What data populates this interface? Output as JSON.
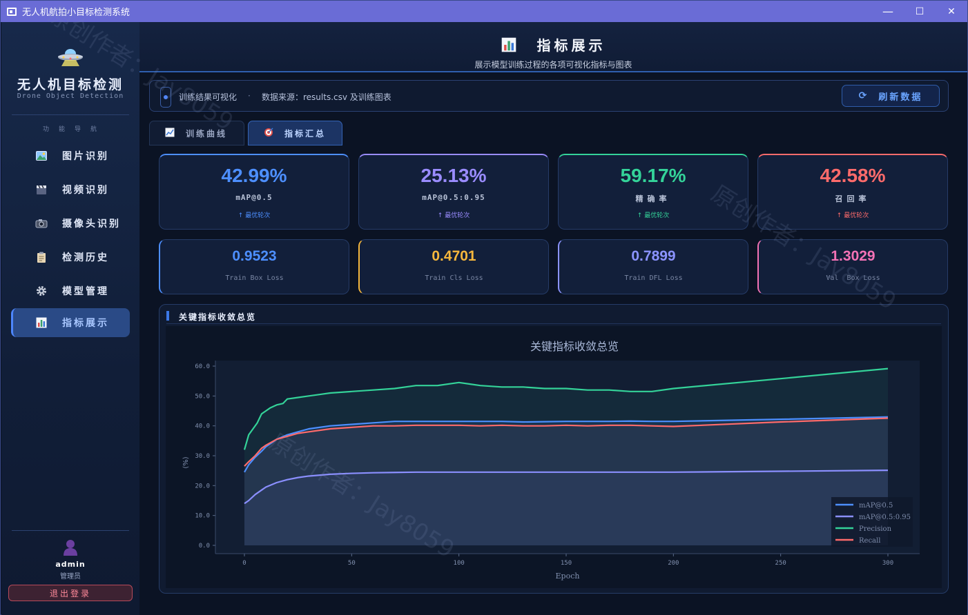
{
  "window": {
    "title": "无人机航拍小目标检测系统",
    "controls": [
      "—",
      "☐",
      "✕"
    ]
  },
  "sidebar": {
    "brand_title": "无人机目标检测",
    "brand_sub": "Drone Object Detection",
    "nav_caption": "功能导航",
    "items": [
      {
        "label": "图片识别",
        "icon": "image-icon"
      },
      {
        "label": "视频识别",
        "icon": "clapper-icon"
      },
      {
        "label": "摄像头识别",
        "icon": "camera-icon"
      },
      {
        "label": "检测历史",
        "icon": "clipboard-icon"
      },
      {
        "label": "模型管理",
        "icon": "gear-icon"
      },
      {
        "label": "指标展示",
        "icon": "bar-chart-icon",
        "active": true
      }
    ],
    "user": {
      "name": "admin",
      "role": "管理员"
    },
    "logout_label": "退出登录"
  },
  "header": {
    "title": "指标展示",
    "subtitle": "展示模型训练过程的各项可视化指标与图表"
  },
  "infobar": {
    "text": "训练结果可视化",
    "separator": "·",
    "source": "数据来源：results.csv 及训练图表",
    "refresh_label": "刷新数据"
  },
  "tabs": [
    {
      "label": "训练曲线",
      "active": false
    },
    {
      "label": "指标汇总",
      "active": true
    }
  ],
  "metric_cards": [
    {
      "value": "42.99%",
      "label": "mAP@0.5",
      "note": "↑ 最优轮次",
      "color": "#4d8fff"
    },
    {
      "value": "25.13%",
      "label": "mAP@0.5:0.95",
      "note": "↑ 最优轮次",
      "color": "#9a8cff"
    },
    {
      "value": "59.17%",
      "label": "精确率",
      "note": "↑ 最优轮次",
      "color": "#34d399"
    },
    {
      "value": "42.58%",
      "label": "召回率",
      "note": "↑ 最优轮次",
      "color": "#ff6b6b"
    }
  ],
  "loss_cards": [
    {
      "value": "0.9523",
      "label": "Train Box Loss",
      "color": "#4d8fff"
    },
    {
      "value": "0.4701",
      "label": "Train Cls Loss",
      "color": "#f6b73c"
    },
    {
      "value": "0.7899",
      "label": "Train DFL Loss",
      "color": "#8b93ff"
    },
    {
      "value": "1.3029",
      "label": "Val  Box Loss",
      "color": "#f472b6"
    }
  ],
  "chart_panel_title": "关键指标收敛总览",
  "chart_data": {
    "type": "line",
    "title": "关键指标收敛总览",
    "xlabel": "Epoch",
    "ylabel": "(%)",
    "xlim": [
      0,
      300
    ],
    "ylim": [
      0,
      60
    ],
    "xticks": [
      0,
      50,
      100,
      150,
      200,
      250,
      300
    ],
    "yticks": [
      "0.0",
      "10.0",
      "20.0",
      "30.0",
      "40.0",
      "50.0",
      "60.0"
    ],
    "grid": false,
    "legend_position": "bottom-right",
    "series": [
      {
        "name": "mAP@0.5",
        "color": "#4d8fff",
        "x": [
          0,
          2,
          5,
          8,
          10,
          15,
          20,
          25,
          30,
          40,
          50,
          60,
          70,
          80,
          90,
          100,
          110,
          120,
          130,
          140,
          150,
          160,
          170,
          180,
          190,
          200,
          250,
          300
        ],
        "y": [
          24.5,
          27,
          29.5,
          31.5,
          33,
          35.5,
          37,
          38,
          39,
          40,
          40.5,
          41,
          41.5,
          41.5,
          41.5,
          41.5,
          41.5,
          41.5,
          41.3,
          41.4,
          41.5,
          41.5,
          41.5,
          41.6,
          41.5,
          41.5,
          42.2,
          42.99
        ]
      },
      {
        "name": "mAP@0.5:0.95",
        "color": "#8b8fff",
        "x": [
          0,
          2,
          5,
          8,
          10,
          15,
          20,
          25,
          30,
          40,
          50,
          60,
          70,
          80,
          90,
          100,
          120,
          140,
          160,
          180,
          200,
          250,
          300
        ],
        "y": [
          14,
          15,
          17,
          18.5,
          19.5,
          21,
          22,
          22.7,
          23.2,
          23.8,
          24.1,
          24.3,
          24.4,
          24.5,
          24.5,
          24.5,
          24.5,
          24.5,
          24.5,
          24.5,
          24.5,
          24.8,
          25.13
        ]
      },
      {
        "name": "Precision",
        "color": "#34d399",
        "x": [
          0,
          2,
          4,
          6,
          8,
          10,
          12,
          15,
          18,
          20,
          25,
          30,
          35,
          40,
          50,
          60,
          70,
          80,
          90,
          100,
          105,
          110,
          120,
          130,
          140,
          150,
          160,
          170,
          180,
          190,
          200,
          250,
          300
        ],
        "y": [
          32,
          37,
          39,
          41,
          44,
          45,
          46,
          47,
          47.5,
          49,
          49.5,
          50,
          50.5,
          51,
          51.5,
          52,
          52.5,
          53.5,
          53.5,
          54.5,
          54,
          53.5,
          53,
          53,
          52.5,
          52.5,
          52,
          52,
          51.5,
          51.5,
          52.5,
          55.8,
          59.17
        ]
      },
      {
        "name": "Recall",
        "color": "#ff6b6b",
        "x": [
          0,
          2,
          5,
          8,
          10,
          15,
          20,
          25,
          30,
          40,
          50,
          60,
          70,
          80,
          90,
          100,
          110,
          120,
          130,
          140,
          150,
          160,
          170,
          180,
          190,
          200,
          250,
          300
        ],
        "y": [
          26.5,
          28,
          30,
          32.5,
          33.5,
          35.5,
          36.5,
          37.5,
          38,
          39,
          39.5,
          40,
          40,
          40.2,
          40.2,
          40.2,
          40,
          40.2,
          40,
          40,
          40.2,
          40,
          40.2,
          40.2,
          40,
          39.8,
          41.3,
          42.58
        ]
      }
    ]
  }
}
